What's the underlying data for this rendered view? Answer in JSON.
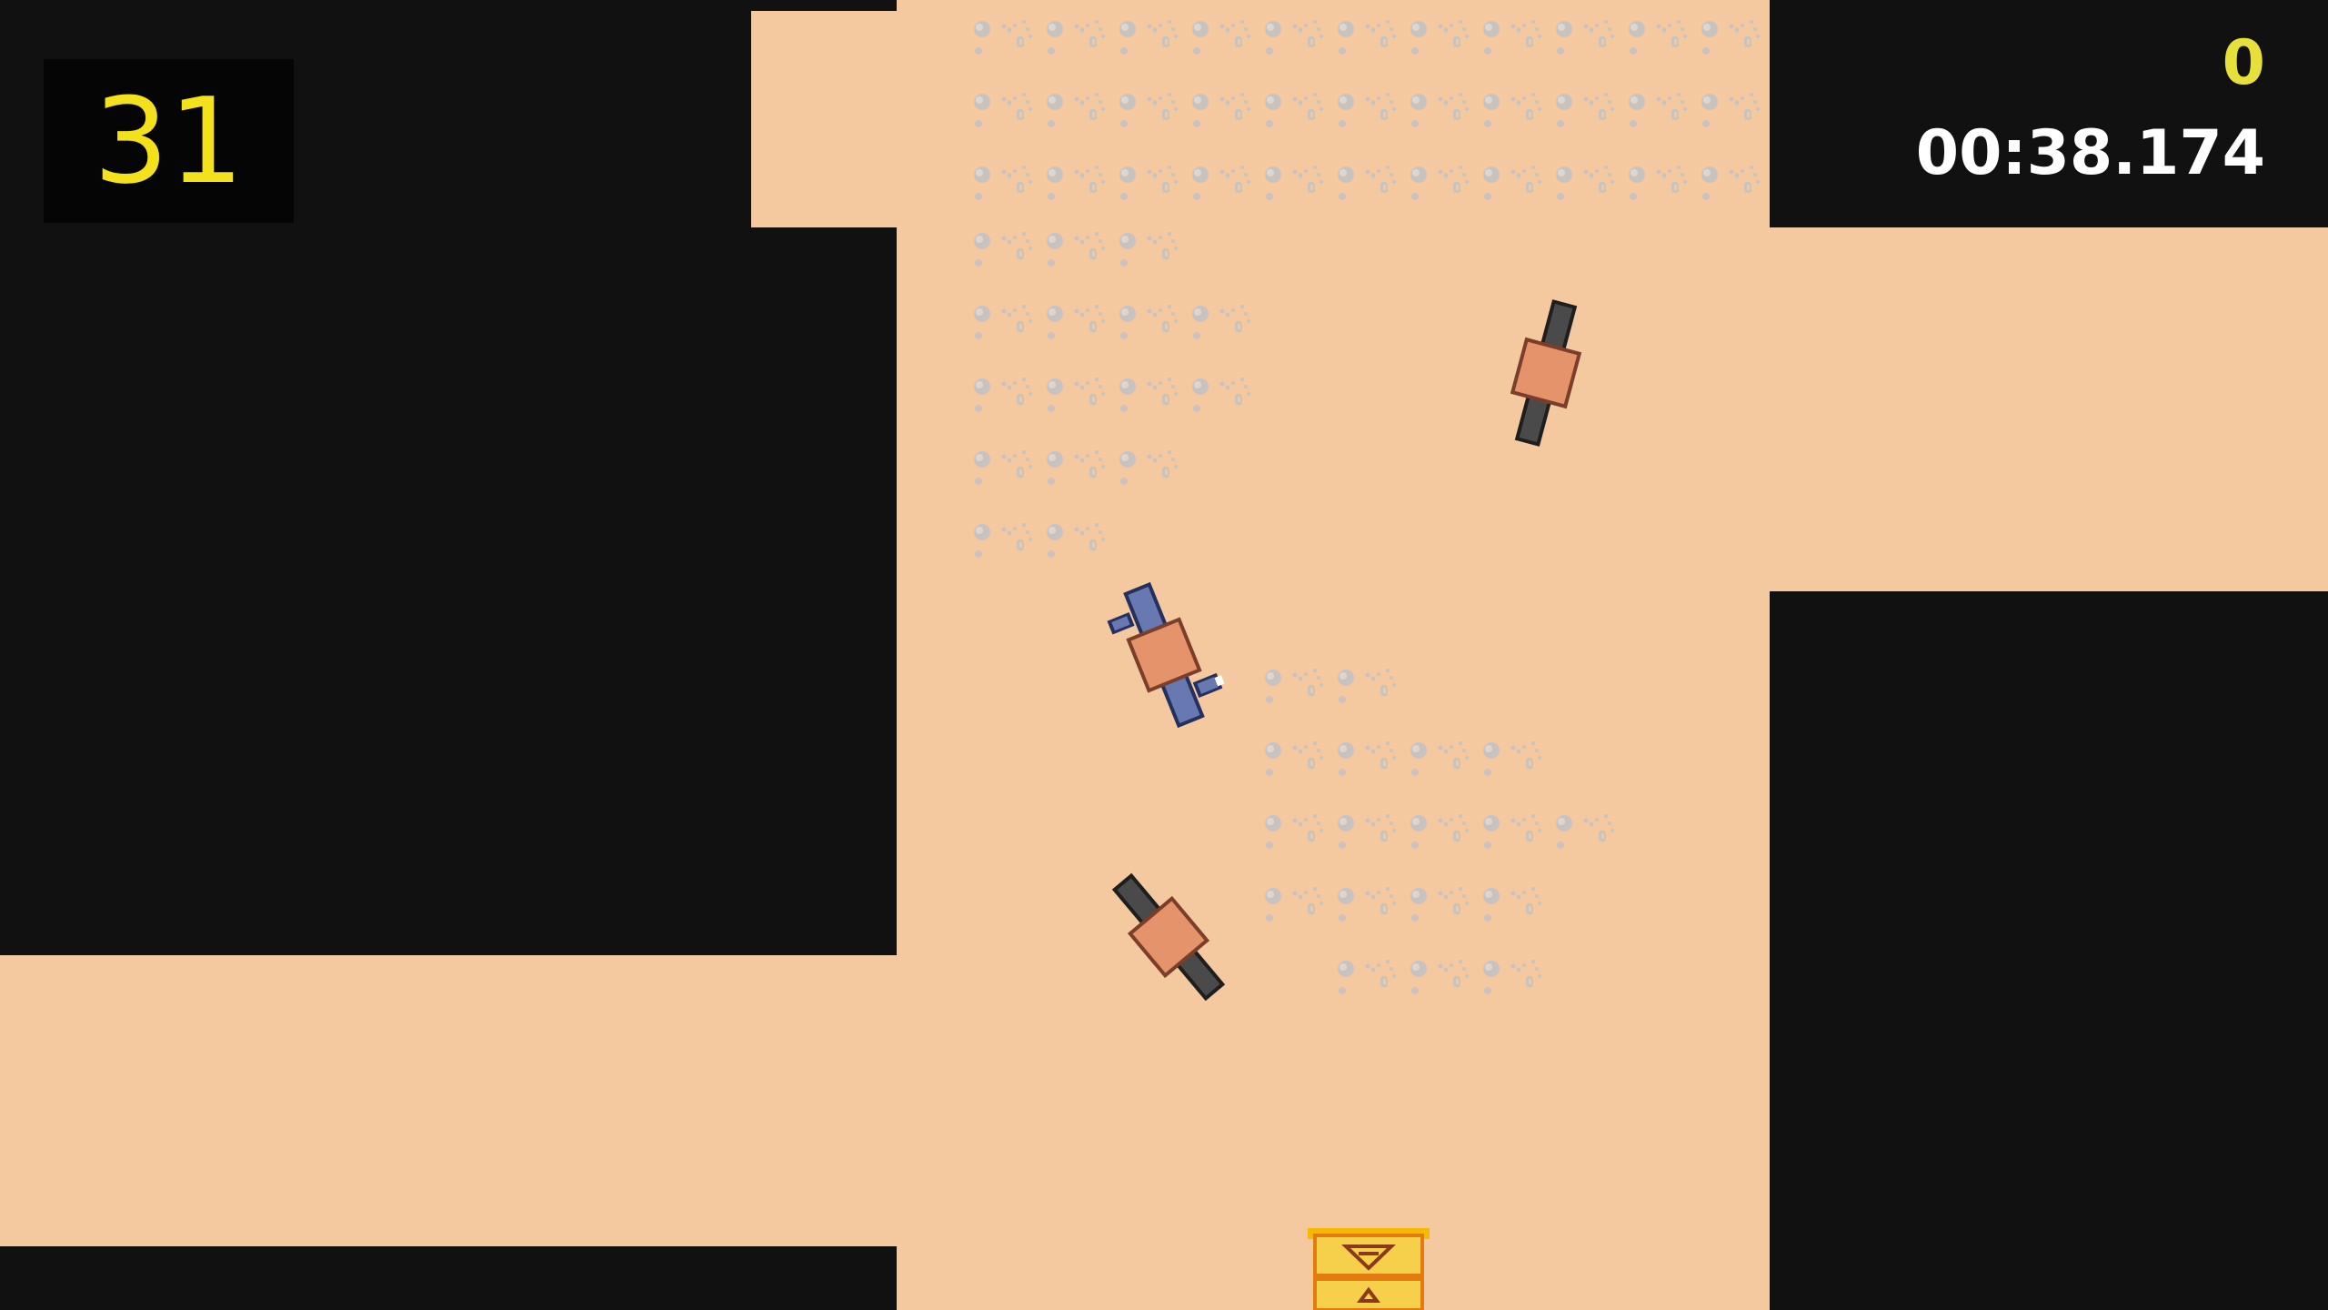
{
  "hud": {
    "level": "31",
    "score": "0",
    "timer": "00:38.174"
  },
  "colors": {
    "sand": "#f5c9a0",
    "wall": "#111111",
    "pebble": "#c9c3bf",
    "level_text": "#f2e11b",
    "score_text": "#e8e03a",
    "timer_text": "#ffffff",
    "player_bike": "#6878b0",
    "enemy_bike": "#4a4a4a",
    "rider": "#e5936a",
    "checkpoint": "#f6b800"
  },
  "sprites": {
    "player": "player-motorbike-icon",
    "enemies": [
      "enemy-motorbike-icon",
      "enemy-motorbike-icon"
    ],
    "checkpoint": "checkpoint-marker-icon",
    "pebbles": "pebble-gravel-icon"
  }
}
